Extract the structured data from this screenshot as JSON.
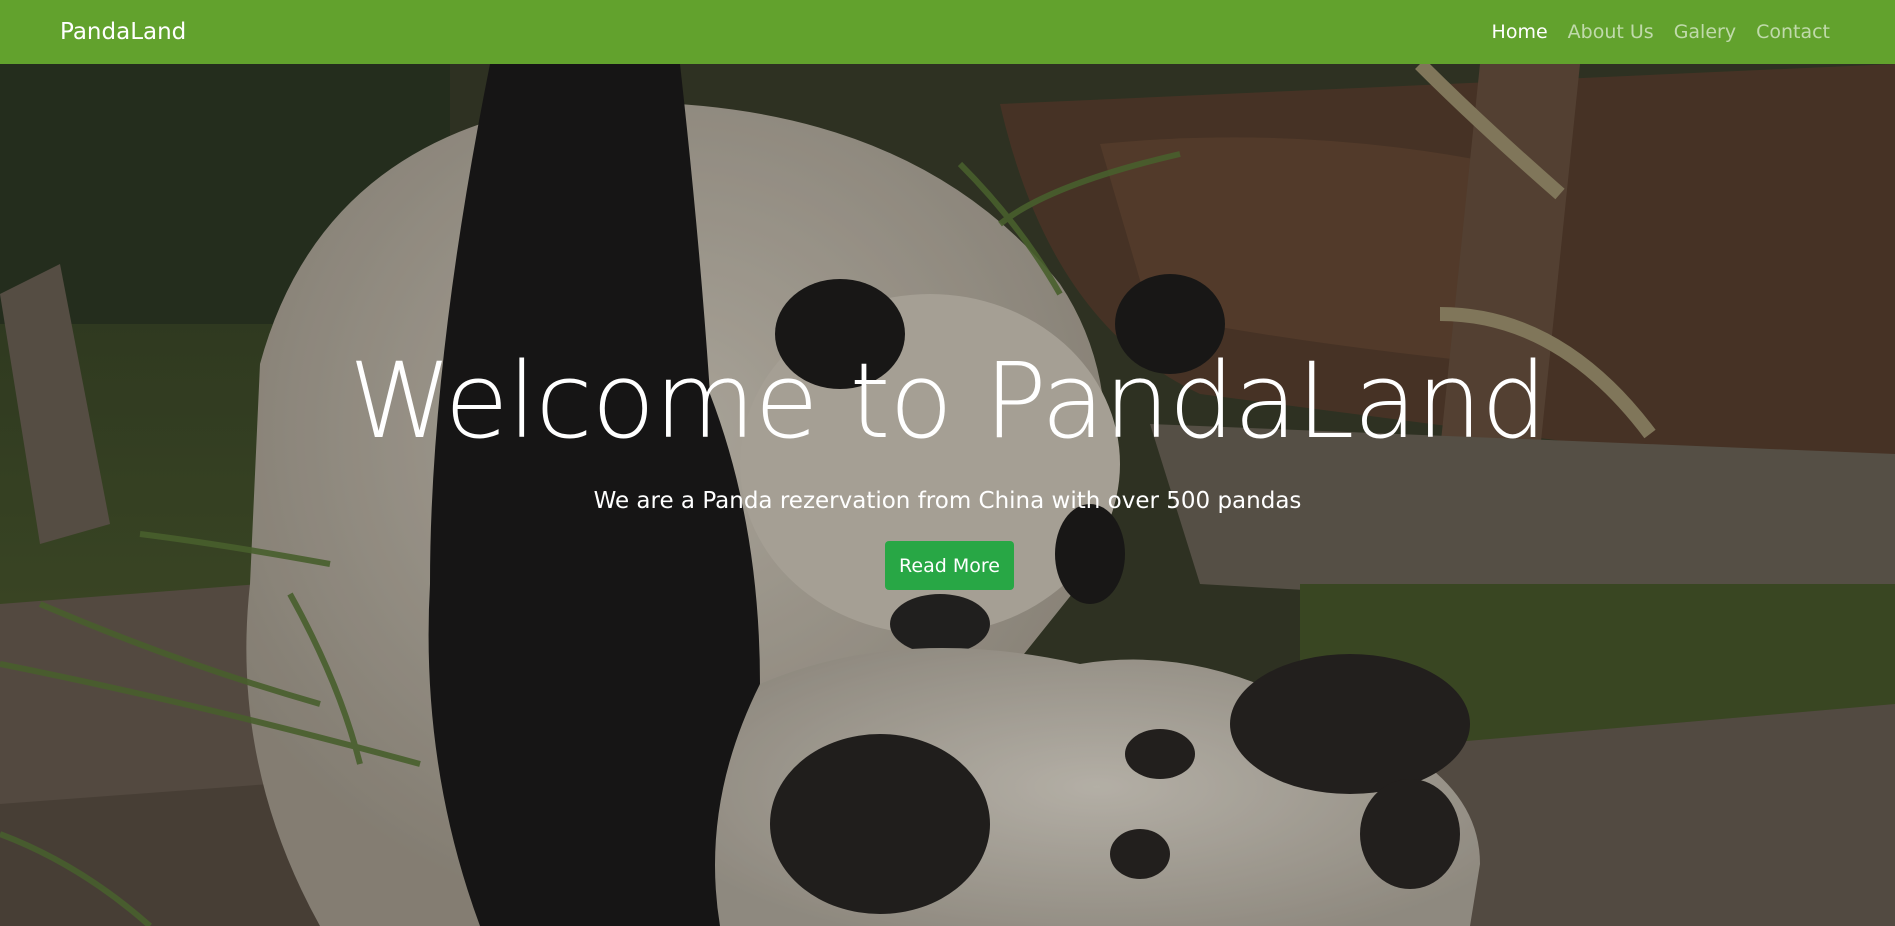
{
  "navbar": {
    "brand": "PandaLand",
    "links": [
      {
        "label": "Home",
        "active": true
      },
      {
        "label": "About Us",
        "active": false
      },
      {
        "label": "Galery",
        "active": false
      },
      {
        "label": "Contact",
        "active": false
      }
    ]
  },
  "hero": {
    "title": "Welcome to PandaLand",
    "subtitle": "We are a Panda rezervation from China with over 500 pandas",
    "button_label": "Read More"
  },
  "colors": {
    "navbar_bg": "#62a22d",
    "button_bg": "#28a745",
    "text": "#ffffff"
  }
}
